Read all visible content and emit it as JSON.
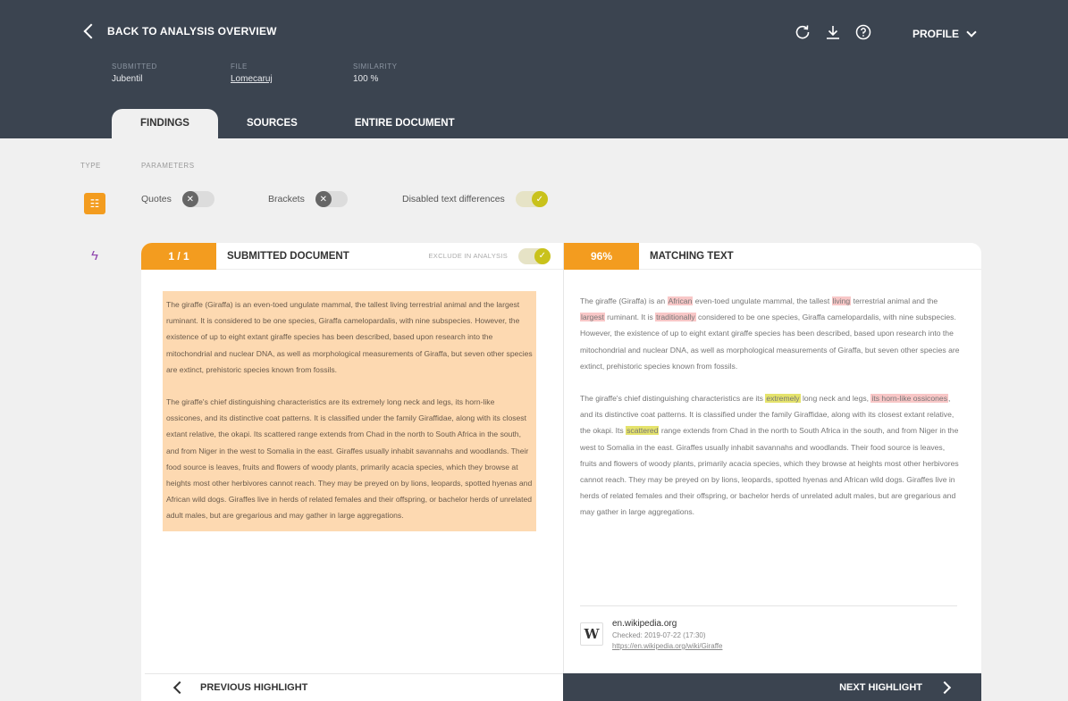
{
  "header": {
    "back_label": "BACK TO ANALYSIS OVERVIEW",
    "profile_label": "PROFILE",
    "icons": [
      "refresh-icon",
      "download-icon",
      "help-icon"
    ],
    "meta": [
      {
        "key": "SUBMITTED",
        "value": "Jubentil"
      },
      {
        "key": "FILE",
        "value": "Lomecaruj"
      },
      {
        "key": "SIMILARITY",
        "value": "100 %"
      }
    ]
  },
  "tabs": [
    {
      "label": "FINDINGS",
      "active": true
    },
    {
      "label": "SOURCES",
      "active": false
    },
    {
      "label": "ENTIRE DOCUMENT",
      "active": false
    }
  ],
  "filters": {
    "type_label": "TYPE",
    "parameters_label": "PARAMETERS",
    "items": [
      {
        "label": "Quotes",
        "state": "off"
      },
      {
        "label": "Brackets",
        "state": "off"
      },
      {
        "label": "Disabled text differences",
        "state": "on"
      }
    ]
  },
  "left_panel": {
    "counter": "1 / 1",
    "title": "SUBMITTED DOCUMENT",
    "exclude_label": "EXCLUDE IN ANALYSIS",
    "paragraphs": [
      "The giraffe (Giraffa) is an even-toed ungulate mammal, the tallest living terrestrial animal and the largest ruminant. It is considered to be one species, Giraffa camelopardalis, with nine subspecies. However, the existence of up to eight extant giraffe species has been described, based upon research into the mitochondrial and nuclear DNA, as well as morphological measurements of Giraffa, but seven other species are extinct, prehistoric species known from fossils.",
      "The giraffe's chief distinguishing characteristics are its extremely long neck and legs, its horn-like ossicones, and its distinctive coat patterns. It is classified under the family Giraffidae, along with its closest extant relative, the okapi. Its scattered range extends from Chad in the north to South Africa in the south, and from Niger in the west to Somalia in the east. Giraffes usually inhabit savannahs and woodlands. Their food source is leaves, fruits and flowers of woody plants, primarily acacia species, which they browse at heights most other herbivores cannot reach. They may be preyed on by lions, leopards, spotted hyenas and African wild dogs. Giraffes live in herds of related females and their offspring, or bachelor herds of unrelated adult males, but are gregarious and may gather in large aggregations."
    ]
  },
  "right_panel": {
    "percent": "96%",
    "title": "MATCHING TEXT",
    "p1": {
      "a": "The giraffe (Giraffa) is an ",
      "h1": "African",
      "b": " even-toed ungulate mammal, the tallest ",
      "h2": "living",
      "c": " terrestrial animal and the ",
      "h3": "largest",
      "d": " ruminant. It is ",
      "h4": "traditionally",
      "e": " considered to be one species, Giraffa camelopardalis, with nine subspecies. However, the existence of up to eight extant giraffe species has been described, based upon research into the mitochondrial and nuclear DNA, as well as morphological measurements of Giraffa, but seven other species are extinct, prehistoric species known from fossils."
    },
    "p2": {
      "a": "The giraffe's chief distinguishing characteristics are its ",
      "h1": "extremely",
      "b": " long neck and legs, ",
      "h2": "its horn-like ossicones",
      "c": ", and its distinctive coat patterns. It is classified under the family Giraffidae, along with its closest extant relative, the okapi. Its ",
      "h3": "scattered",
      "d": " range extends from Chad in the north to South Africa in the south, and from Niger in the west to Somalia in the east. Giraffes usually inhabit savannahs and woodlands. Their food source is leaves, fruits and flowers of woody plants, primarily acacia species, which they browse at heights most other herbivores cannot reach. They may be preyed on by lions, leopards, spotted hyenas and African wild dogs. Giraffes live in herds of related females and their offspring, or bachelor herds of unrelated adult males, but are gregarious and may gather in large aggregations."
    },
    "source": {
      "badge": "W",
      "domain": "en.wikipedia.org",
      "checked": "Checked: 2019-07-22 (17:30)",
      "url": "https://en.wikipedia.org/wiki/Giraffe"
    }
  },
  "nav": {
    "prev_label": "PREVIOUS HIGHLIGHT",
    "next_label": "NEXT HIGHLIGHT"
  },
  "colors": {
    "header_bg": "#3b4450",
    "accent": "#f39c1f",
    "highlight_submitted": "#fdd9b1",
    "highlight_red": "#f8c7c7",
    "highlight_yellow": "#e5e36c",
    "toggle_on": "#c9c21b"
  }
}
